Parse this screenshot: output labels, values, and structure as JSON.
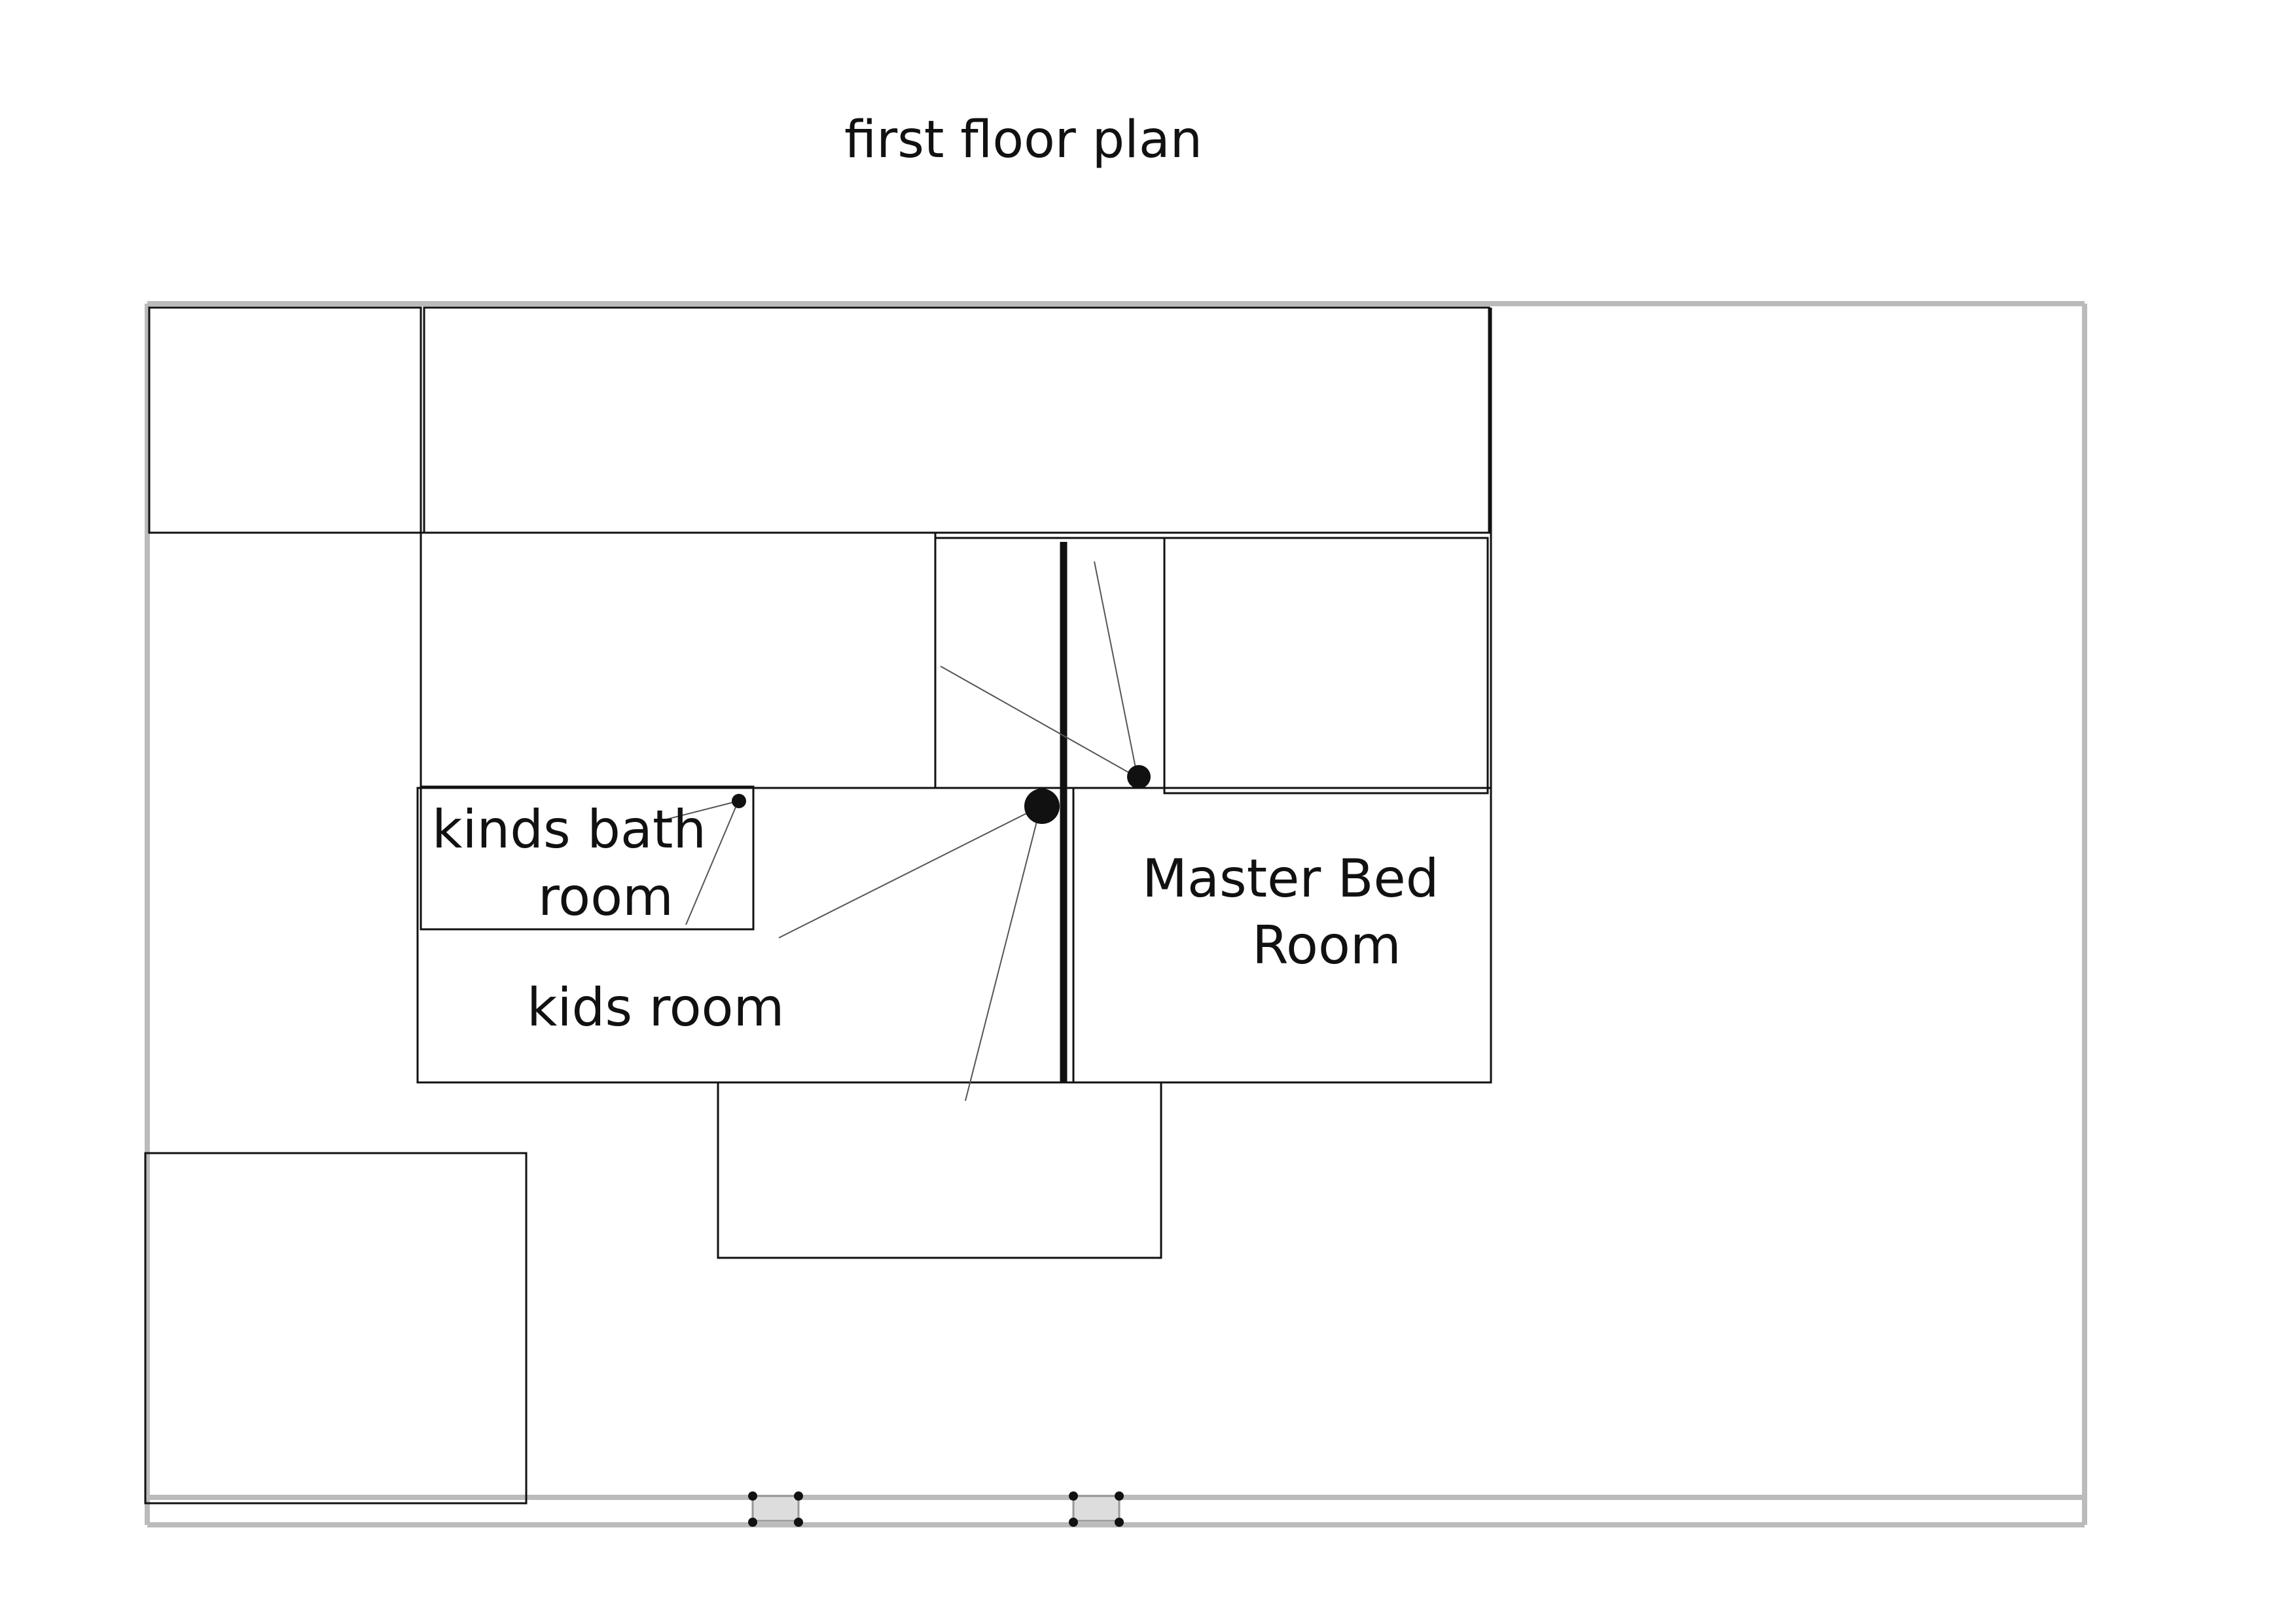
{
  "title": "first floor plan",
  "rooms": {
    "kids_bath": {
      "line1": "kinds bath",
      "line2": "room"
    },
    "kids_room": {
      "label": "kids room"
    },
    "master_bed": {
      "line1": "Master Bed",
      "line2": "Room"
    }
  },
  "colors": {
    "outline": "#bbbbbb",
    "walls": "#111111"
  }
}
